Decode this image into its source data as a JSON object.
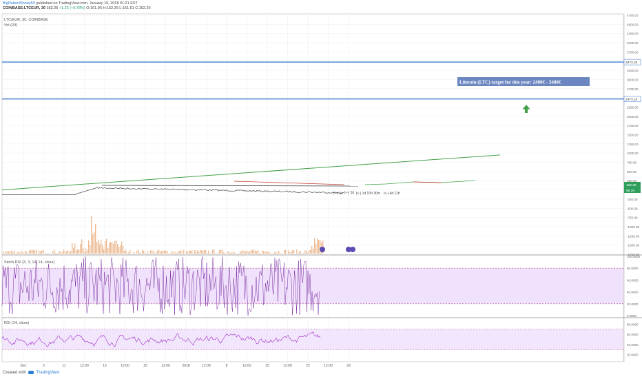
{
  "header": {
    "author_line": "BigRubenMoney59 published on TradingView.com, January 19, 2018 01:21 EST",
    "author": "BigRubenMoney59",
    "author_rest": " published on TradingView.com, January 19, 2018 01:21 EST",
    "ticker": "COINBASE:LTCEUR, 30",
    "price": "162.26",
    "change": "+1.25 (+0.78%)",
    "ohlc": "O:161.96 H:162.26 L:161.51 C:162.20"
  },
  "main_pane": {
    "legend": "LTC/EUR, 30, COINBASE",
    "volume_legend": "Vol (20)"
  },
  "annotation": {
    "text": "Litecoin (LTC) target for this year: 2400€ - 3400€",
    "color": "#6b86c0"
  },
  "measure_labels": [
    "|<-| 1c",
    "|<-| 1d",
    "|<-| 1d 10h 30m",
    "|<-| 4d 11h"
  ],
  "stoch_legend": "Stoch RSI (3, 3, 14, 14, close)",
  "rsi_legend": "RSI (14, close)",
  "footer": {
    "created_with": "Created with",
    "brand": "TradingView"
  },
  "colors": {
    "horizontal_line": "#7aa2e0",
    "trend_green": "#43a047",
    "price_line": "#555555",
    "stoch_line": "#7a2ea0",
    "stoch_fill": "#e6cdfa",
    "rsi_line": "#9e2bc7",
    "volume": "#e6a06a",
    "arrow": "#43a047",
    "last_price_badge": "#2e9e5a"
  },
  "chart_data": [
    {
      "type": "line",
      "title": "LTC/EUR, 30, COINBASE",
      "x_ticks": [
        "Dec",
        "5",
        "11",
        "12:00",
        "15",
        "12:00",
        "25",
        "12:00",
        "2018",
        "12:00",
        "8",
        "12:00",
        "15",
        "12:00",
        "22",
        "12:00",
        "29"
      ],
      "y_ticks": [
        4750,
        4500,
        4250,
        4000,
        3750,
        3500,
        3250,
        3000,
        2750,
        2500,
        2250,
        2000,
        1750,
        1500,
        1250,
        1000,
        750,
        500,
        250,
        0,
        -250,
        -500,
        -750,
        -1000,
        -1250,
        -1500,
        -1750
      ],
      "ylim": [
        -1750,
        4750
      ],
      "horizontal_levels": [
        {
          "value": 3473.25,
          "label": "3473.25"
        },
        {
          "value": 2473.14,
          "label": "2473.14"
        }
      ],
      "last_price_labels": [
        "162.26",
        "96.26"
      ],
      "trendline": {
        "x": [
          "Dec 1",
          "Jan 29"
        ],
        "y": [
          0,
          950
        ]
      }
    },
    {
      "type": "line",
      "title": "Stoch RSI (3, 3, 14, 14, close)",
      "y_ticks": [
        100,
        80,
        60,
        40,
        20,
        0
      ],
      "ylim": [
        0,
        100
      ],
      "bands": [
        80,
        20
      ]
    },
    {
      "type": "line",
      "title": "RSI (14, close)",
      "y_ticks": [
        80,
        60,
        40,
        20
      ],
      "ylim": [
        10,
        90
      ],
      "bands": [
        70,
        30
      ]
    }
  ]
}
